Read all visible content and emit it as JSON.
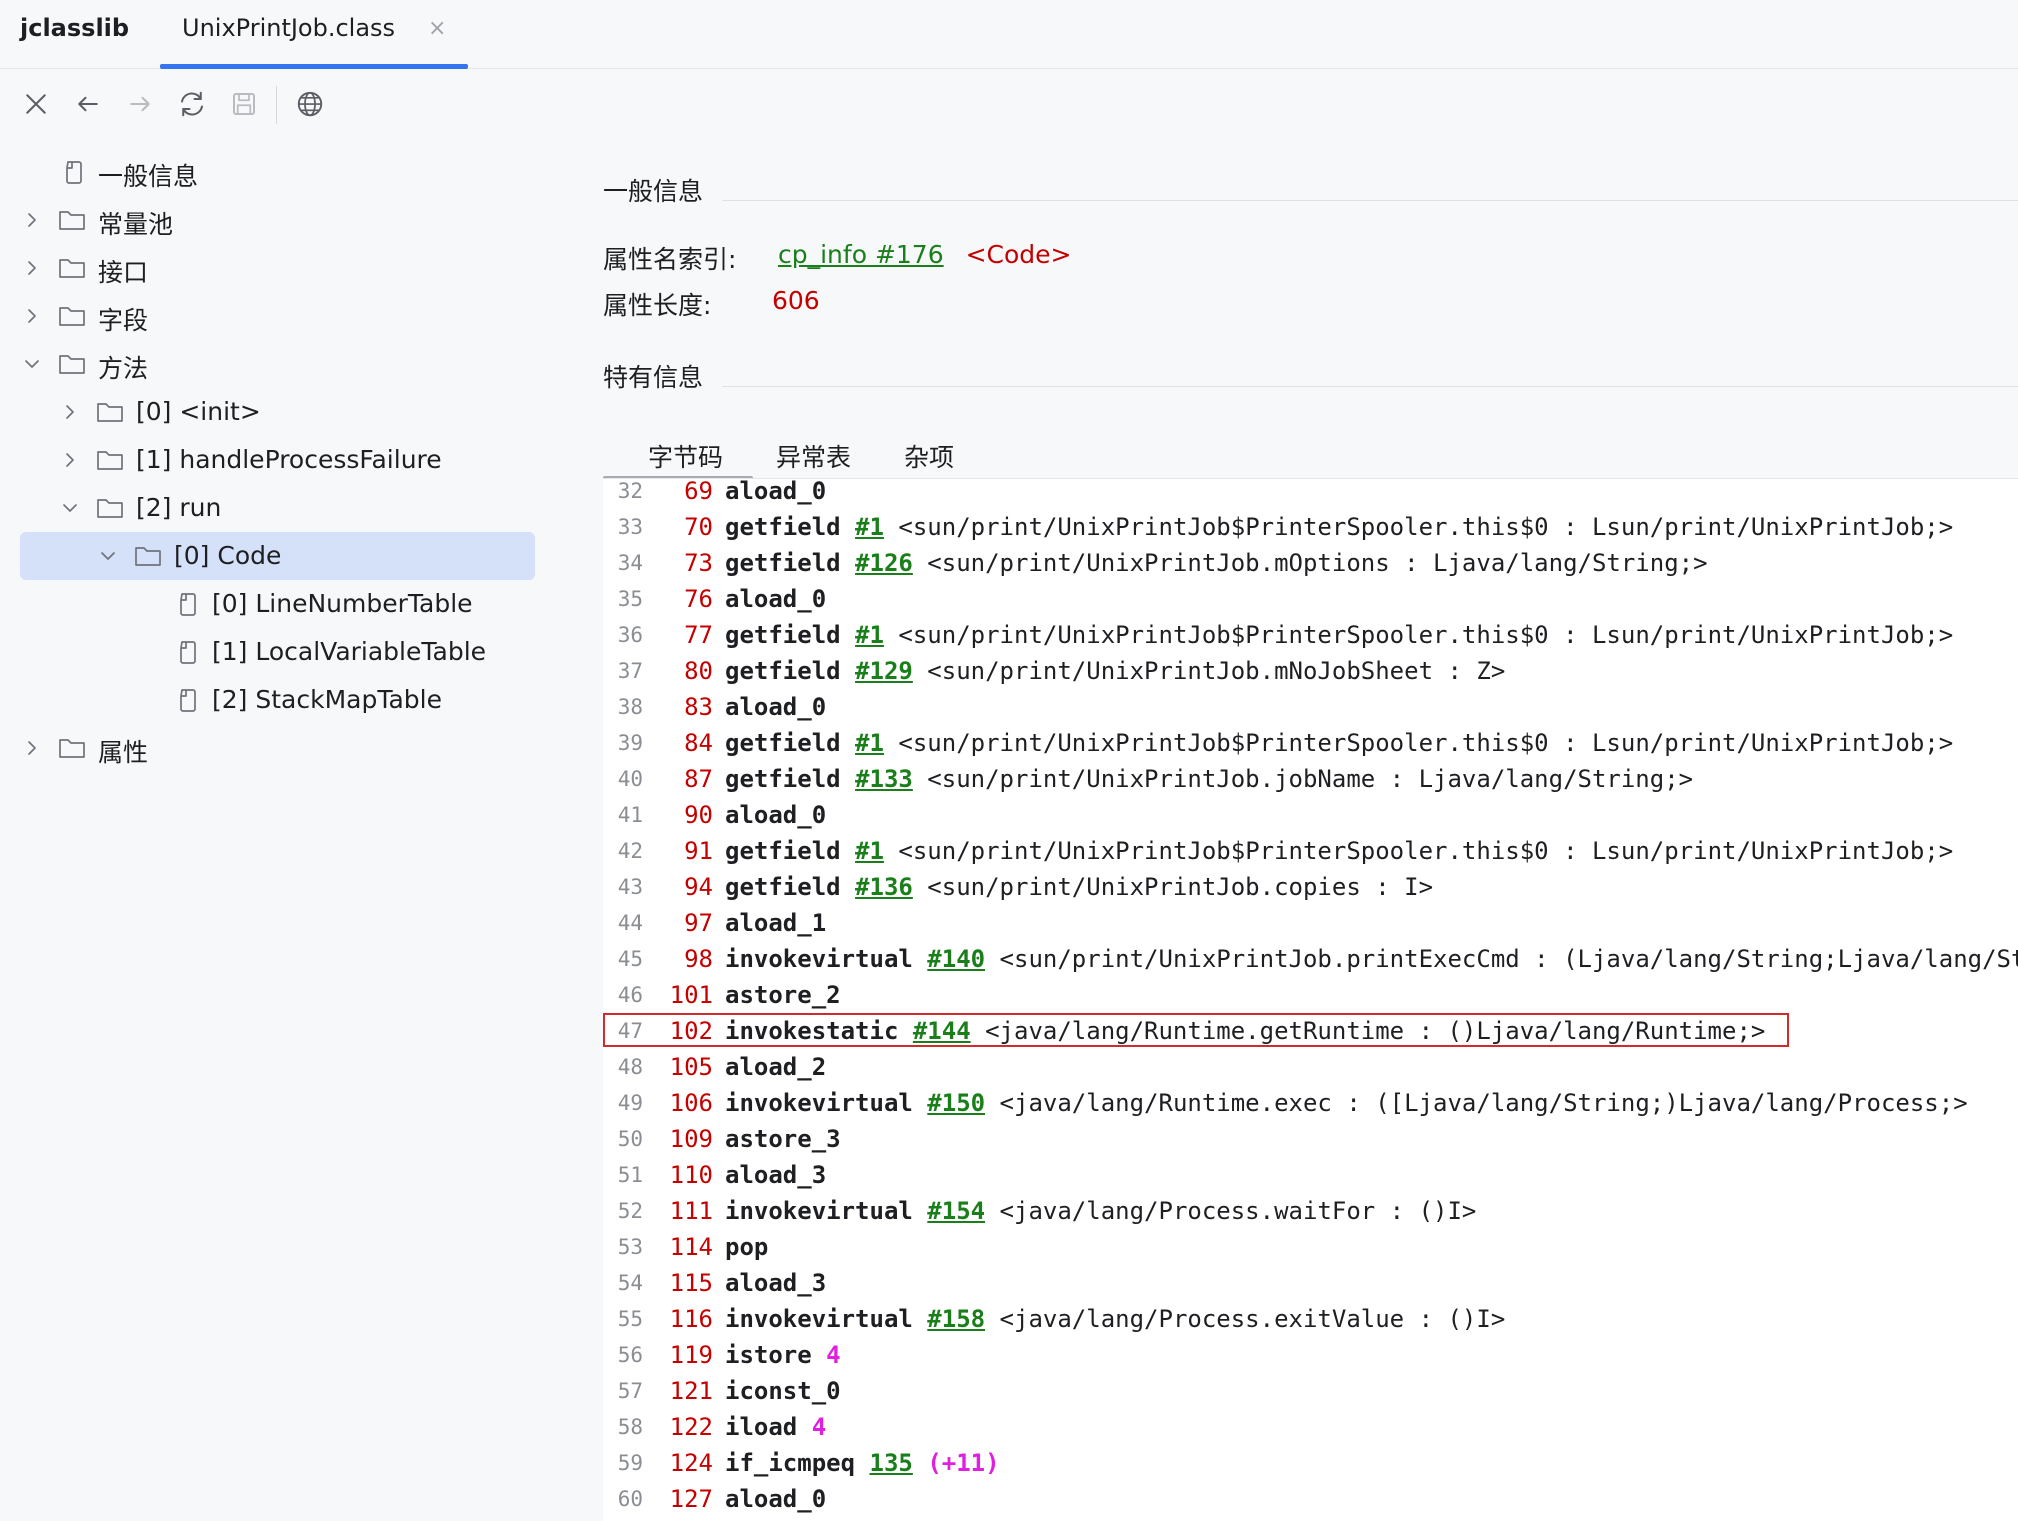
{
  "app": {
    "title": "jclasslib"
  },
  "tab": {
    "label": "UnixPrintJob.class",
    "close_glyph": "×"
  },
  "toolbar": {
    "icons": [
      "close-icon",
      "back-arrow-icon",
      "forward-arrow-icon",
      "refresh-icon",
      "save-icon",
      "globe-icon"
    ]
  },
  "tree": {
    "general": "一般信息",
    "constant_pool": "常量池",
    "interfaces": "接口",
    "fields": "字段",
    "methods": "方法",
    "method_0": "[0] <init>",
    "method_1": "[1] handleProcessFailure",
    "method_2": "[2] run",
    "code": "[0] Code",
    "line_number_table": "[0] LineNumberTable",
    "local_variable_table": "[1] LocalVariableTable",
    "stack_map_table": "[2] StackMapTable",
    "attributes": "属性"
  },
  "general_info": {
    "title": "一般信息",
    "name_index_label": "属性名索引:",
    "name_index_link": "cp_info #176",
    "name_index_value": "<Code>",
    "length_label": "属性长度:",
    "length_value": "606"
  },
  "specific_info": {
    "title": "特有信息",
    "tabs": [
      "字节码",
      "异常表",
      "杂项"
    ]
  },
  "colors": {
    "accent": "#3574f0",
    "selection": "#d5e1f8",
    "offset_red": "#c40000",
    "link_green": "#1a7f1a",
    "operand_magenta": "#e020e0",
    "highlight_border": "#d22b2b"
  },
  "code_lines": [
    {
      "ln": "32",
      "off": "69",
      "op": "aload_0",
      "ref": "",
      "arg": "",
      "cmt": ""
    },
    {
      "ln": "33",
      "off": "70",
      "op": "getfield",
      "ref": "#1",
      "arg": "",
      "cmt": "<sun/print/UnixPrintJob$PrinterSpooler.this$0 : Lsun/print/UnixPrintJob;>"
    },
    {
      "ln": "34",
      "off": "73",
      "op": "getfield",
      "ref": "#126",
      "arg": "",
      "cmt": "<sun/print/UnixPrintJob.mOptions : Ljava/lang/String;>"
    },
    {
      "ln": "35",
      "off": "76",
      "op": "aload_0",
      "ref": "",
      "arg": "",
      "cmt": ""
    },
    {
      "ln": "36",
      "off": "77",
      "op": "getfield",
      "ref": "#1",
      "arg": "",
      "cmt": "<sun/print/UnixPrintJob$PrinterSpooler.this$0 : Lsun/print/UnixPrintJob;>"
    },
    {
      "ln": "37",
      "off": "80",
      "op": "getfield",
      "ref": "#129",
      "arg": "",
      "cmt": "<sun/print/UnixPrintJob.mNoJobSheet : Z>"
    },
    {
      "ln": "38",
      "off": "83",
      "op": "aload_0",
      "ref": "",
      "arg": "",
      "cmt": ""
    },
    {
      "ln": "39",
      "off": "84",
      "op": "getfield",
      "ref": "#1",
      "arg": "",
      "cmt": "<sun/print/UnixPrintJob$PrinterSpooler.this$0 : Lsun/print/UnixPrintJob;>"
    },
    {
      "ln": "40",
      "off": "87",
      "op": "getfield",
      "ref": "#133",
      "arg": "",
      "cmt": "<sun/print/UnixPrintJob.jobName : Ljava/lang/String;>"
    },
    {
      "ln": "41",
      "off": "90",
      "op": "aload_0",
      "ref": "",
      "arg": "",
      "cmt": ""
    },
    {
      "ln": "42",
      "off": "91",
      "op": "getfield",
      "ref": "#1",
      "arg": "",
      "cmt": "<sun/print/UnixPrintJob$PrinterSpooler.this$0 : Lsun/print/UnixPrintJob;>"
    },
    {
      "ln": "43",
      "off": "94",
      "op": "getfield",
      "ref": "#136",
      "arg": "",
      "cmt": "<sun/print/UnixPrintJob.copies : I>"
    },
    {
      "ln": "44",
      "off": "97",
      "op": "aload_1",
      "ref": "",
      "arg": "",
      "cmt": ""
    },
    {
      "ln": "45",
      "off": "98",
      "op": "invokevirtual",
      "ref": "#140",
      "arg": "",
      "cmt": "<sun/print/UnixPrintJob.printExecCmd : (Ljava/lang/String;Ljava/lang/String"
    },
    {
      "ln": "46",
      "off": "101",
      "op": "astore_2",
      "ref": "",
      "arg": "",
      "cmt": ""
    },
    {
      "ln": "47",
      "off": "102",
      "op": "invokestatic",
      "ref": "#144",
      "arg": "",
      "cmt": "<java/lang/Runtime.getRuntime : ()Ljava/lang/Runtime;>"
    },
    {
      "ln": "48",
      "off": "105",
      "op": "aload_2",
      "ref": "",
      "arg": "",
      "cmt": ""
    },
    {
      "ln": "49",
      "off": "106",
      "op": "invokevirtual",
      "ref": "#150",
      "arg": "",
      "cmt": "<java/lang/Runtime.exec : ([Ljava/lang/String;)Ljava/lang/Process;>"
    },
    {
      "ln": "50",
      "off": "109",
      "op": "astore_3",
      "ref": "",
      "arg": "",
      "cmt": ""
    },
    {
      "ln": "51",
      "off": "110",
      "op": "aload_3",
      "ref": "",
      "arg": "",
      "cmt": ""
    },
    {
      "ln": "52",
      "off": "111",
      "op": "invokevirtual",
      "ref": "#154",
      "arg": "",
      "cmt": "<java/lang/Process.waitFor : ()I>"
    },
    {
      "ln": "53",
      "off": "114",
      "op": "pop",
      "ref": "",
      "arg": "",
      "cmt": ""
    },
    {
      "ln": "54",
      "off": "115",
      "op": "aload_3",
      "ref": "",
      "arg": "",
      "cmt": ""
    },
    {
      "ln": "55",
      "off": "116",
      "op": "invokevirtual",
      "ref": "#158",
      "arg": "",
      "cmt": "<java/lang/Process.exitValue : ()I>"
    },
    {
      "ln": "56",
      "off": "119",
      "op": "istore",
      "ref": "",
      "arg": "4",
      "cmt": ""
    },
    {
      "ln": "57",
      "off": "121",
      "op": "iconst_0",
      "ref": "",
      "arg": "",
      "cmt": ""
    },
    {
      "ln": "58",
      "off": "122",
      "op": "iload",
      "ref": "",
      "arg": "4",
      "cmt": ""
    },
    {
      "ln": "59",
      "off": "124",
      "op": "if_icmpeq",
      "ref": "135",
      "arg": "(+11)",
      "cmt": ""
    },
    {
      "ln": "60",
      "off": "127",
      "op": "aload_0",
      "ref": "",
      "arg": "",
      "cmt": ""
    }
  ]
}
